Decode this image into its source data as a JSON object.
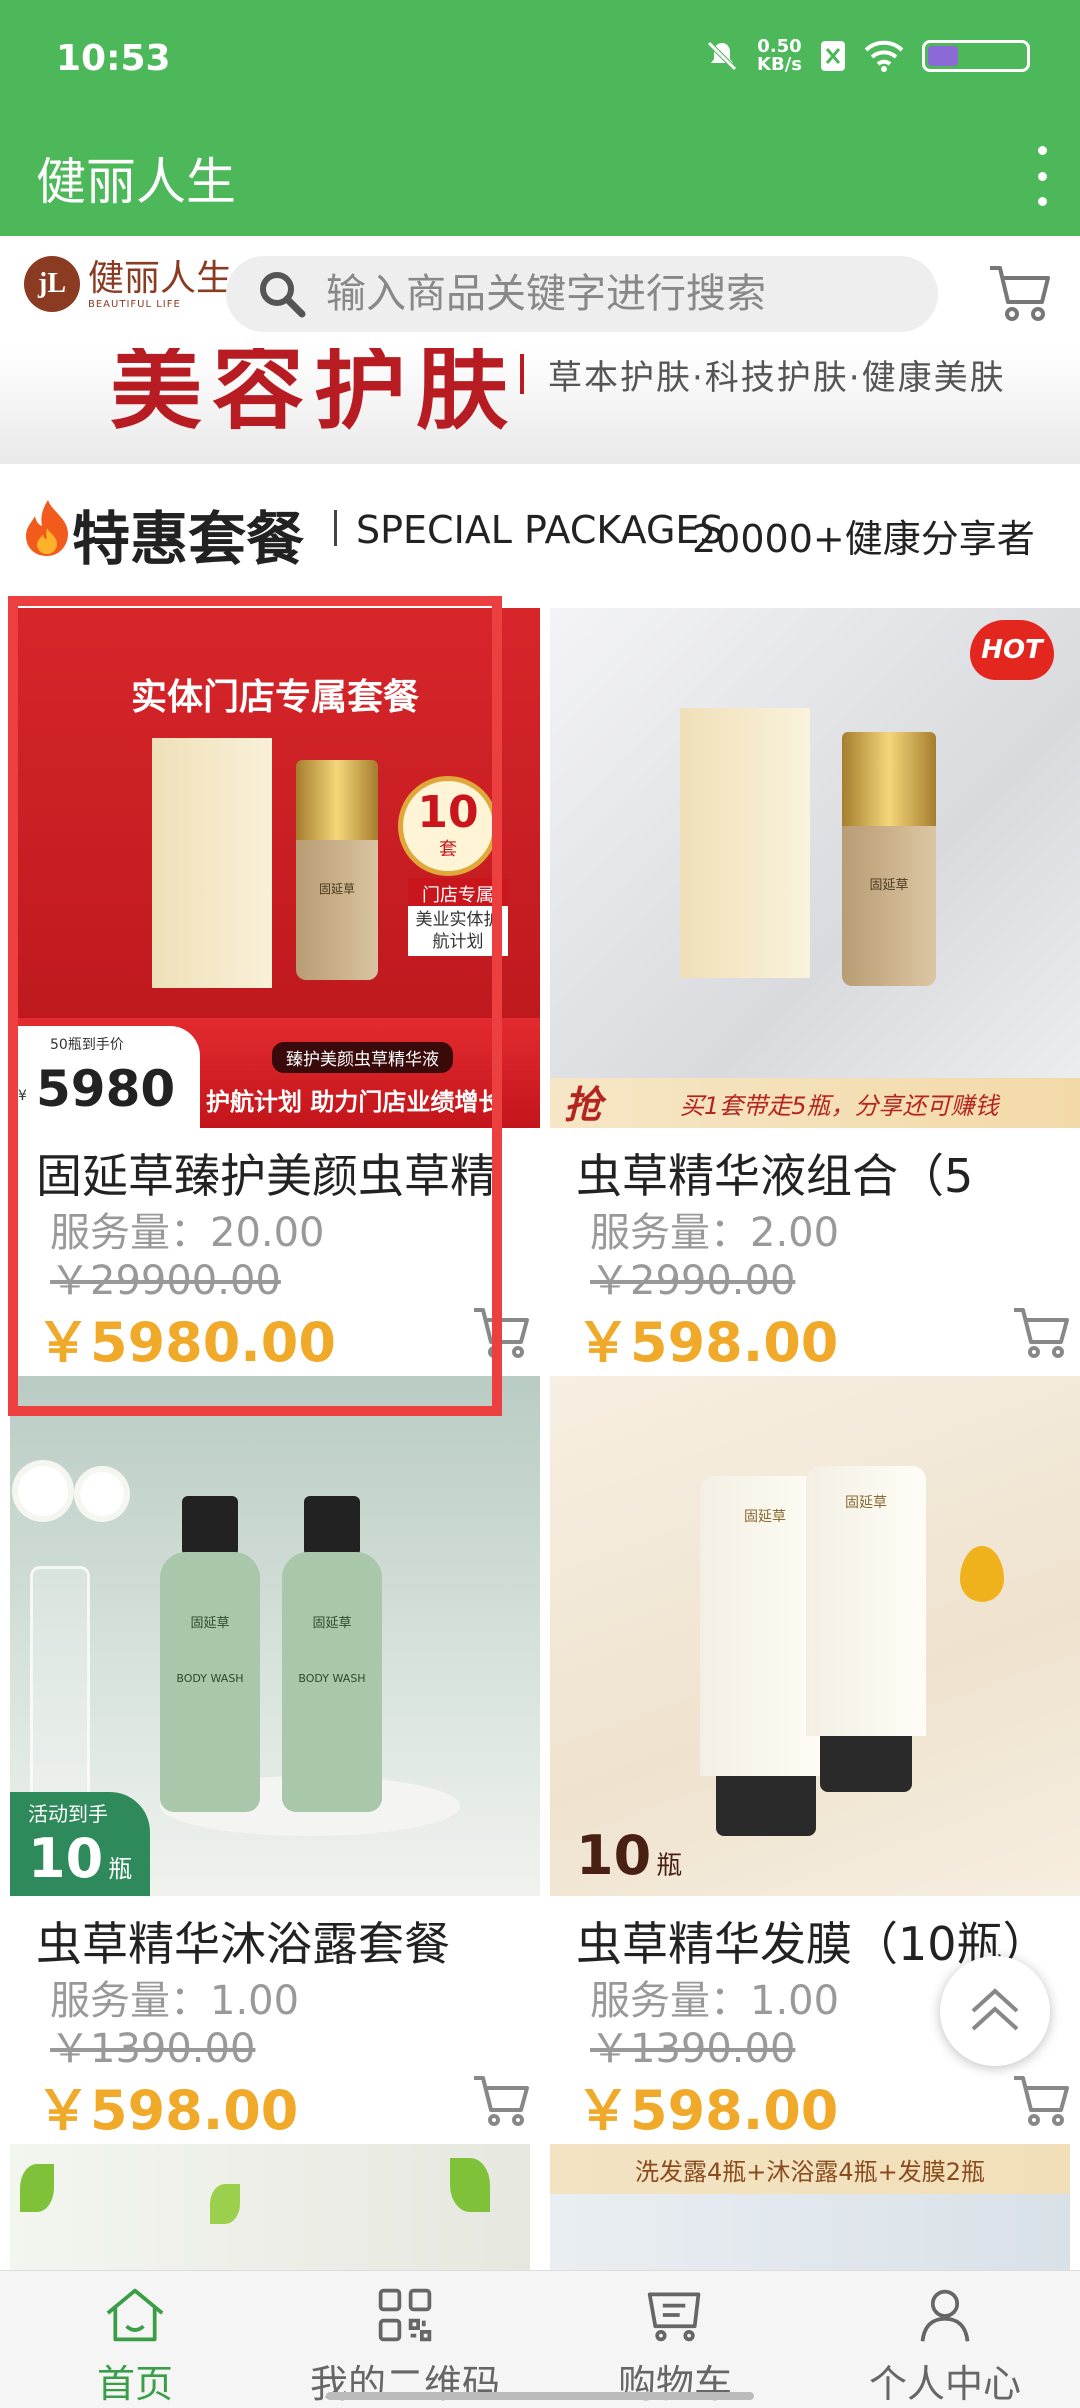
{
  "status_bar": {
    "time": "10:53",
    "net_speed": "0.50",
    "net_unit": "KB/s",
    "battery_level": 0.35
  },
  "app_bar": {
    "title": "健丽人生"
  },
  "brand": {
    "name_cn": "健丽人生",
    "name_en": "BEAUTIFUL LIFE"
  },
  "search": {
    "placeholder": "输入商品关键字进行搜索"
  },
  "banner": {
    "main": "美容护肤",
    "sub": "草本护肤·科技护肤·健康美肤"
  },
  "section": {
    "title": "特惠套餐",
    "subtitle_en": "SPECIAL PACKAGES",
    "count_text": "20000+健康分享者"
  },
  "products": [
    {
      "name": "固延草臻护美颜虫草精",
      "service": "服务量：20.00",
      "original_price": "￥29900.00",
      "price": "￥5980.00",
      "image": {
        "headline": "实体门店专属套餐",
        "badge_num": "10",
        "badge_unit": "套",
        "store_tag": "门店专属",
        "store_note": "美业实体护航计划",
        "bottle_brand": "固延草",
        "price_caption": "50瓶到手价",
        "price_small": "¥",
        "price_big": "5980",
        "product_caption": "臻护美颜虫草精华液",
        "slogan": "护航计划 助力门店业绩增长"
      }
    },
    {
      "name": "虫草精华液组合（5",
      "service": "服务量：2.00",
      "original_price": "￥2990.00",
      "price": "￥598.00",
      "image": {
        "hot": "HOT",
        "bottle_brand": "固延草",
        "grab": "抢",
        "slogan": "买1套带走5瓶，分享还可赚钱"
      }
    },
    {
      "name": "虫草精华沐浴露套餐",
      "service": "服务量：1.00",
      "original_price": "￥1390.00",
      "price": "￥598.00",
      "image": {
        "badge_small": "活动到手",
        "badge_num": "10",
        "badge_unit": "瓶",
        "bottle_brand": "固延草",
        "bottle_label": "BODY WASH"
      }
    },
    {
      "name": "虫草精华发膜（10瓶）",
      "service": "服务量：1.00",
      "original_price": "￥1390.00",
      "price": "￥598.00",
      "image": {
        "badge_num": "10",
        "badge_unit": "瓶",
        "tube_brand": "固延草"
      }
    }
  ],
  "next_row": {
    "right_caption": "洗发露4瓶+沐浴露4瓶+发膜2瓶"
  },
  "bottom_nav": [
    {
      "label": "首页",
      "icon": "home-icon"
    },
    {
      "label": "我的二维码",
      "icon": "qrcode-icon"
    },
    {
      "label": "购物车",
      "icon": "cart-icon"
    },
    {
      "label": "个人中心",
      "icon": "user-icon"
    }
  ],
  "colors": {
    "brand_green": "#4cb85a",
    "price_orange": "#f0a928",
    "active_nav": "#3a9e48",
    "highlight_red": "#ec3f3f"
  }
}
